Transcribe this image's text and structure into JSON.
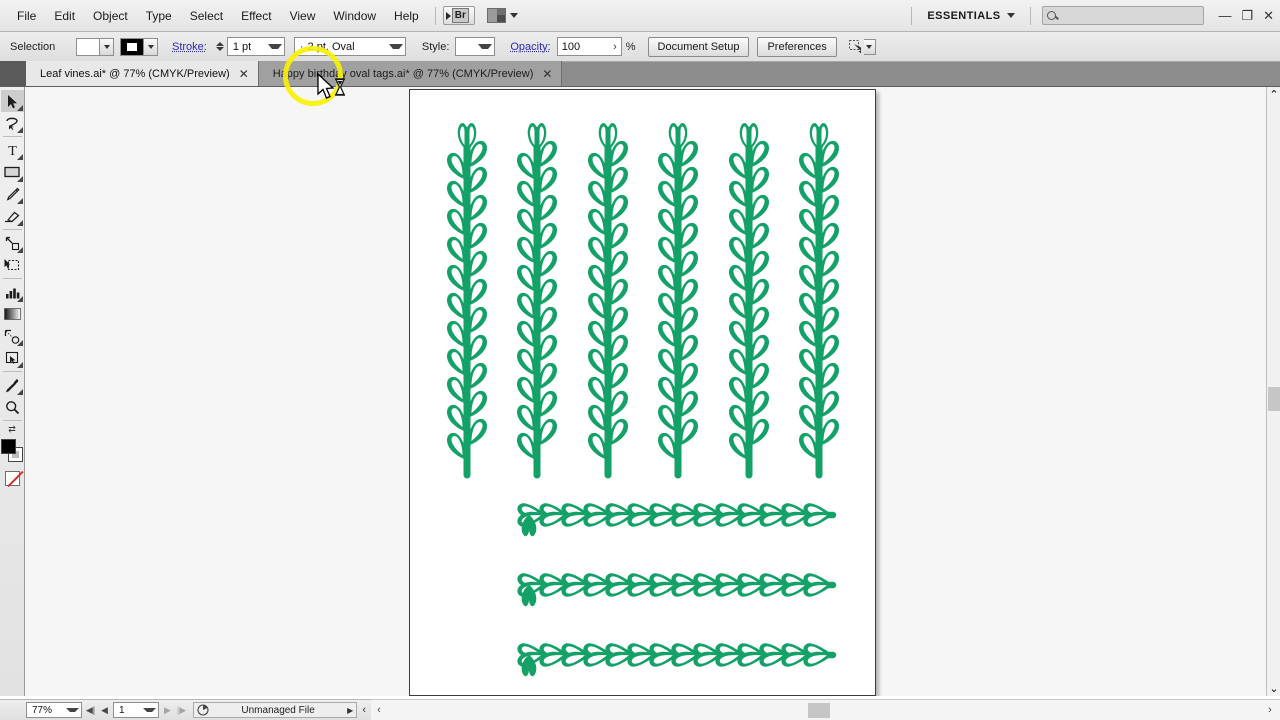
{
  "app": {
    "name": "Adobe Illustrator",
    "workspace": "ESSENTIALS"
  },
  "menubar": {
    "items": [
      {
        "label": "File"
      },
      {
        "label": "Edit"
      },
      {
        "label": "Object"
      },
      {
        "label": "Type"
      },
      {
        "label": "Select"
      },
      {
        "label": "Effect"
      },
      {
        "label": "View"
      },
      {
        "label": "Window"
      },
      {
        "label": "Help"
      }
    ],
    "bridge_label": "Br",
    "arrange_icon": "arrange-documents-icon",
    "workspace_label": "ESSENTIALS",
    "search_placeholder": "",
    "search_value": "",
    "window_minimize": "—",
    "window_restore": "❐",
    "window_close": "✕"
  },
  "controlbar": {
    "tool_name": "Selection",
    "fill_swatch": "fill-swatch",
    "stroke_swatch": "stroke-swatch",
    "stroke_label": "Stroke:",
    "stroke_weight": "1 pt",
    "brush_definition": "2 pt. Oval",
    "brush_prefix": "·",
    "style_label": "Style:",
    "style_value": "",
    "opacity_label": "Opacity:",
    "opacity_value": "100",
    "opacity_unit": "%",
    "opacity_arrow": "›",
    "document_setup_label": "Document Setup",
    "preferences_label": "Preferences",
    "transform_icon": "transform-each-icon"
  },
  "tabs": [
    {
      "title": "Leaf vines.ai* @ 77% (CMYK/Preview)",
      "active": true,
      "close": "✕"
    },
    {
      "title": "Happy birthday oval tags.ai* @ 77% (CMYK/Preview)",
      "active": false,
      "close": "✕"
    }
  ],
  "toolbar": {
    "tools": [
      {
        "name": "selection-tool",
        "icon": "arrow-pointer",
        "selected": true,
        "has_flyout": true
      },
      {
        "name": "lasso-tool",
        "icon": "lasso",
        "selected": false,
        "has_flyout": true
      },
      {
        "name": "type-tool",
        "icon": "type-T",
        "selected": false,
        "has_flyout": true
      },
      {
        "name": "rectangle-tool",
        "icon": "rectangle",
        "selected": false,
        "has_flyout": true
      },
      {
        "name": "pencil-tool",
        "icon": "pencil",
        "selected": false,
        "has_flyout": true
      },
      {
        "name": "eraser-tool",
        "icon": "eraser",
        "selected": false,
        "has_flyout": true
      },
      {
        "name": "scale-tool",
        "icon": "scale",
        "selected": false,
        "has_flyout": true
      },
      {
        "name": "free-transform-tool",
        "icon": "free-transform",
        "selected": false,
        "has_flyout": false
      },
      {
        "name": "column-graph-tool",
        "icon": "bar-chart",
        "selected": false,
        "has_flyout": true
      },
      {
        "name": "gradient-tool",
        "icon": "gradient",
        "selected": false,
        "has_flyout": false
      },
      {
        "name": "blend-tool",
        "icon": "blend",
        "selected": false,
        "has_flyout": true
      },
      {
        "name": "slice-tool",
        "icon": "slice",
        "selected": false,
        "has_flyout": true
      },
      {
        "name": "eyedropper-tool",
        "icon": "eyedropper",
        "selected": false,
        "has_flyout": true
      },
      {
        "name": "zoom-tool",
        "icon": "magnifier",
        "selected": false,
        "has_flyout": false
      }
    ],
    "fill_stroke": {
      "fill_color": "#000000",
      "stroke_color": "#ffffff",
      "swap_icon": "swap-fill-stroke-icon",
      "none_icon": "none-swatch-icon"
    }
  },
  "statusbar": {
    "zoom_level": "77%",
    "first_page": "◀|",
    "prev_page": "◀",
    "page_number": "1",
    "next_page": "▶",
    "last_page": "|▶",
    "doc_icon": "document-info-icon",
    "status_text": "Unmanaged File",
    "status_menu_arrow": "▶",
    "collapse_arrow": "‹"
  },
  "scrollbars": {
    "v_up": "⌃",
    "v_down": "⌄",
    "h_left": "‹",
    "h_right": "›"
  },
  "canvas": {
    "artboard_bg": "#ffffff",
    "canvas_bg": "#f6f6f6",
    "artwork_color": "#13a167",
    "artwork_highlight": "#ffffff",
    "vertical_vines_count": 6,
    "horizontal_vines_count": 3,
    "artwork_description": "Leaf vine illustrations"
  },
  "overlay": {
    "highlight_color": "#f7f007",
    "highlight_name": "click-highlight-ring",
    "cursor_icon": "arrow-cursor",
    "busy_icon": "hourglass-busy-icon"
  }
}
